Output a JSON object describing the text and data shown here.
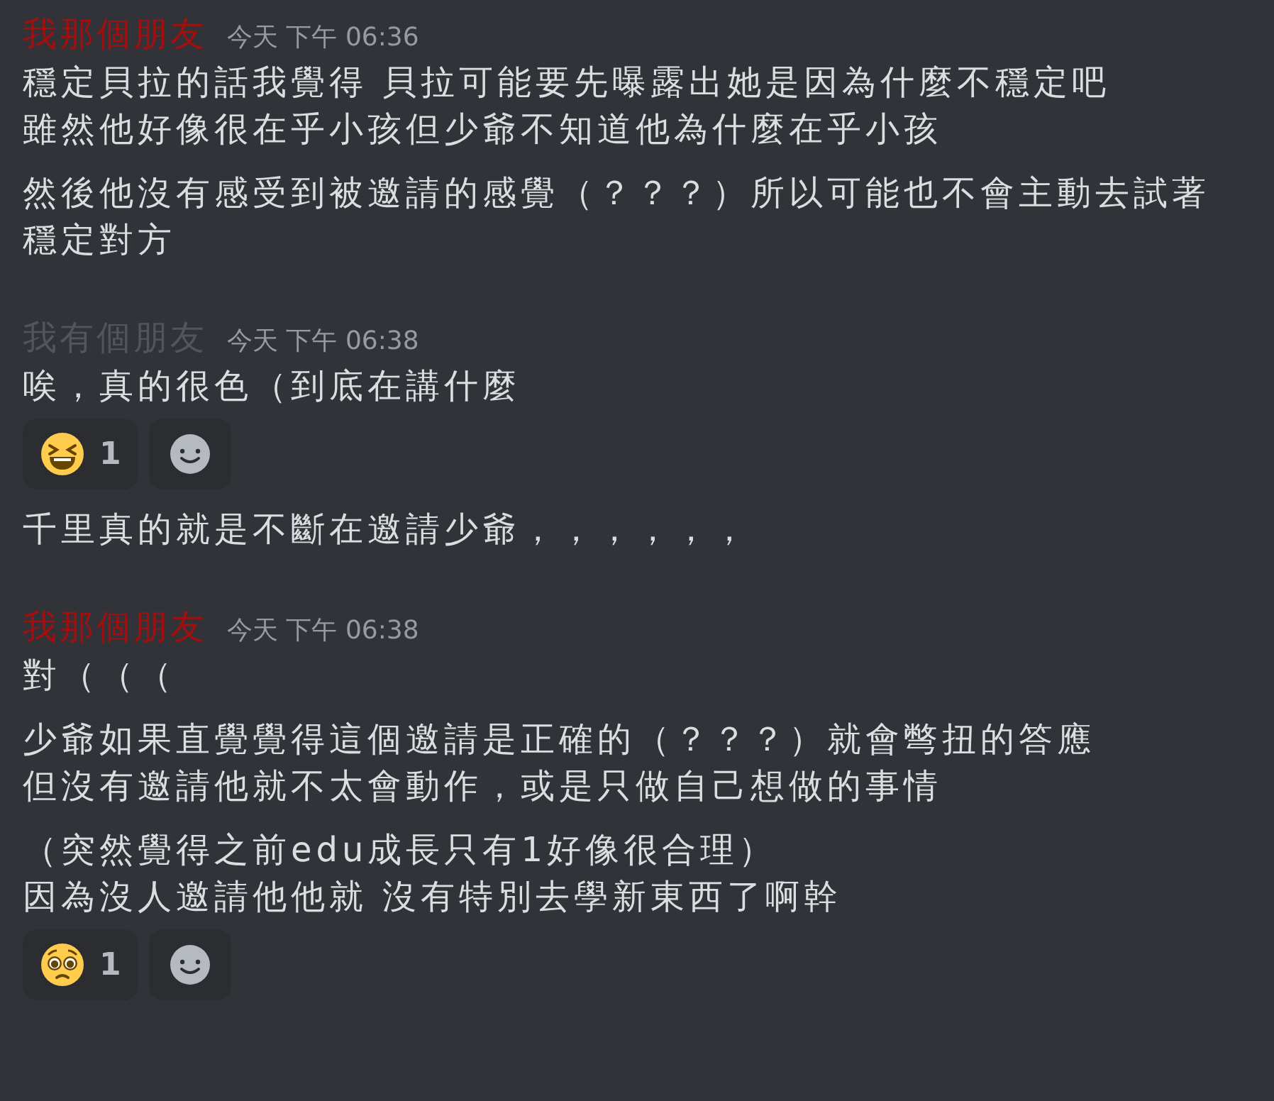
{
  "groups": [
    {
      "author": "我那個朋友",
      "color": "#a30f0f",
      "timestamp": "今天 下午 06:36",
      "messages": [
        {
          "lines": [
            "穩定貝拉的話我覺得 貝拉可能要先曝露出她是因為什麼不穩定吧",
            "雖然他好像很在乎小孩但少爺不知道他為什麼在乎小孩"
          ]
        },
        {
          "lines": [
            "然後他沒有感受到被邀請的感覺（？？？）所以可能也不會主動去試著",
            "穩定對方"
          ]
        }
      ]
    },
    {
      "author": "我有個朋友",
      "color": "#52555c",
      "timestamp": "今天 下午 06:38",
      "messages": [
        {
          "lines": [
            "唉，真的很色（到底在講什麼"
          ],
          "reactions": [
            {
              "kind": "laugh",
              "count": "1"
            }
          ]
        },
        {
          "lines": [
            "千里真的就是不斷在邀請少爺，，，，，，"
          ]
        }
      ]
    },
    {
      "author": "我那個朋友",
      "color": "#a30f0f",
      "timestamp": "今天 下午 06:38",
      "messages": [
        {
          "lines": [
            "對（（（"
          ]
        },
        {
          "lines": [
            "少爺如果直覺覺得這個邀請是正確的（？？？）就會彆扭的答應",
            "但沒有邀請他就不太會動作，或是只做自己想做的事情"
          ]
        },
        {
          "lines": [
            "（突然覺得之前edu成長只有1好像很合理）",
            "因為沒人邀請他他就 沒有特別去學新東西了啊幹"
          ],
          "reactions": [
            {
              "kind": "pleading",
              "count": "1"
            }
          ]
        }
      ]
    }
  ]
}
